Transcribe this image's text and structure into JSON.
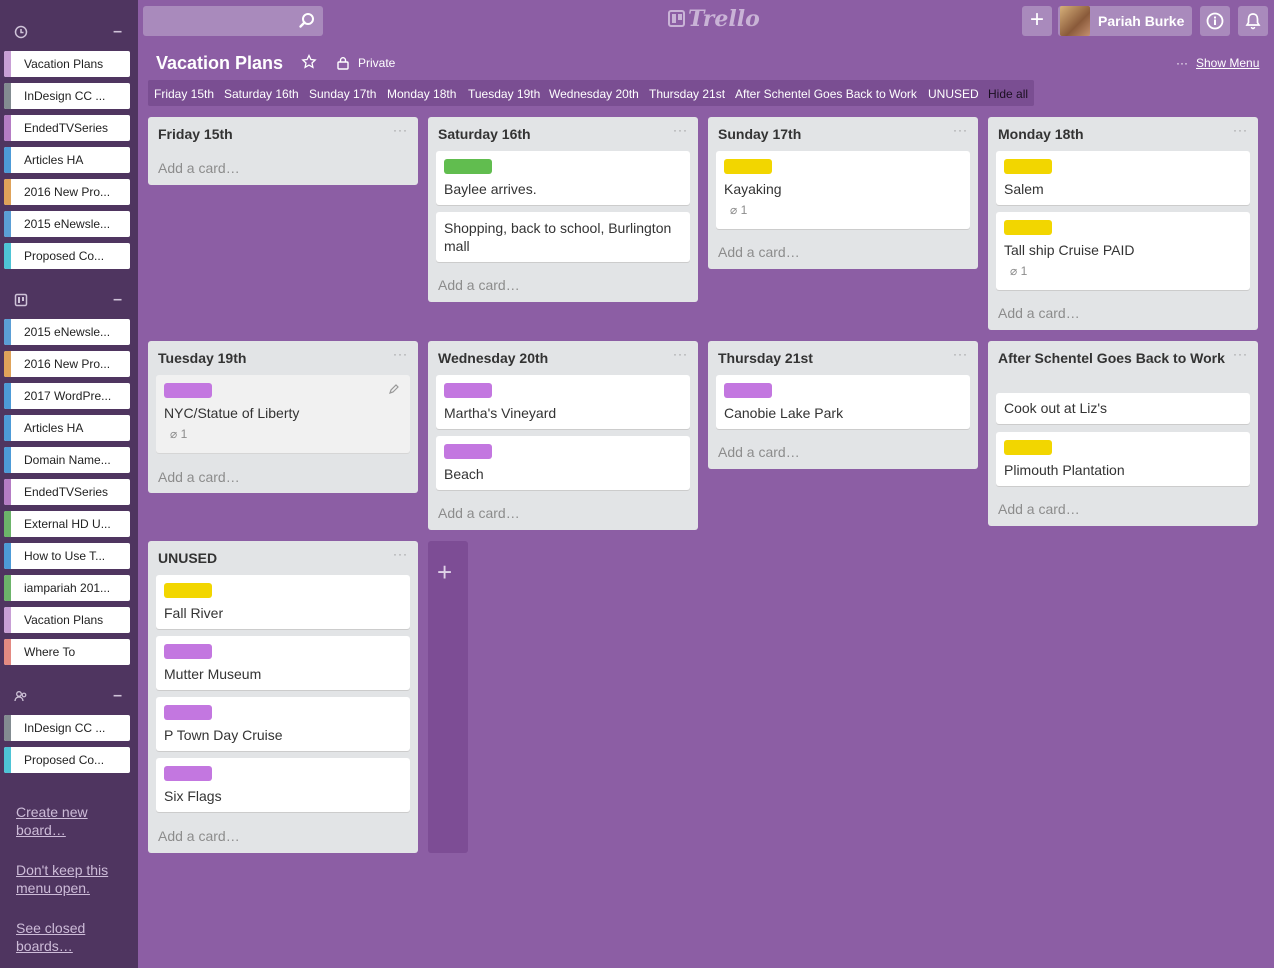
{
  "colors": {
    "sidebar_bg": "#4f3560",
    "board_bg": "#8c5ea4",
    "green": "#61bd4f",
    "yellow": "#f2d600",
    "purple": "#c377e0"
  },
  "sidebar": {
    "groups": [
      {
        "icon": "clock-icon",
        "items": [
          {
            "label": "Vacation Plans",
            "color": "#c89fd5"
          },
          {
            "label": "InDesign CC ...",
            "color": "#838c91"
          },
          {
            "label": "EndedTVSeries",
            "color": "#b57cc4"
          },
          {
            "label": "Articles HA",
            "color": "#4d9bd8"
          },
          {
            "label": "2016 New Pro...",
            "color": "#e0a35a"
          },
          {
            "label": "2015 eNewsle...",
            "color": "#5b9fd6"
          },
          {
            "label": "Proposed Co...",
            "color": "#4ec4d6"
          }
        ]
      },
      {
        "icon": "board-icon",
        "items": [
          {
            "label": "2015 eNewsle...",
            "color": "#5b9fd6"
          },
          {
            "label": "2016 New Pro...",
            "color": "#e0a35a"
          },
          {
            "label": "2017 WordPre...",
            "color": "#4d9bd8"
          },
          {
            "label": "Articles HA",
            "color": "#4d9bd8"
          },
          {
            "label": "Domain Name...",
            "color": "#4d9bd8"
          },
          {
            "label": "EndedTVSeries",
            "color": "#b57cc4"
          },
          {
            "label": "External HD U...",
            "color": "#6cb46a"
          },
          {
            "label": "How to Use T...",
            "color": "#4d9bd8"
          },
          {
            "label": "iampariah 201...",
            "color": "#6cb46a"
          },
          {
            "label": "Vacation Plans",
            "color": "#c89fd5"
          },
          {
            "label": "Where To",
            "color": "#e48a82"
          }
        ]
      },
      {
        "icon": "team-icon",
        "items": [
          {
            "label": "InDesign CC ...",
            "color": "#838c91"
          },
          {
            "label": "Proposed Co...",
            "color": "#4ec4d6"
          }
        ]
      }
    ],
    "links": [
      "Create new board…",
      "Don't keep this menu open.",
      "See closed boards…"
    ]
  },
  "header": {
    "logo": "Trello",
    "user_name": "Pariah Burke"
  },
  "board": {
    "title": "Vacation Plans",
    "privacy": "Private",
    "show_menu": "Show Menu",
    "filters": [
      "Friday 15th",
      "Saturday 16th",
      "Sunday 17th",
      "Monday 18th",
      "Tuesday 19th",
      "Wednesday 20th",
      "Thursday 21st",
      "After Schentel Goes Back to Work",
      "UNUSED",
      "Hide all"
    ],
    "add_card": "Add a card…",
    "lists": [
      {
        "title": "Friday 15th",
        "cards": []
      },
      {
        "title": "Saturday 16th",
        "cards": [
          {
            "label": "green",
            "text": "Baylee arrives."
          },
          {
            "label": null,
            "text": "Shopping, back to school, Burlington mall"
          }
        ]
      },
      {
        "title": "Sunday 17th",
        "cards": [
          {
            "label": "yellow",
            "text": "Kayaking",
            "attachments": "1"
          }
        ]
      },
      {
        "title": "Monday 18th",
        "cards": [
          {
            "label": "yellow",
            "text": "Salem"
          },
          {
            "label": "yellow",
            "text": "Tall ship Cruise PAID",
            "attachments": "1"
          }
        ]
      },
      {
        "title": "Tuesday 19th",
        "cards": [
          {
            "label": "purple",
            "text": "NYC/Statue of Liberty",
            "attachments": "1"
          }
        ]
      },
      {
        "title": "Wednesday 20th",
        "cards": [
          {
            "label": "purple",
            "text": "Martha's Vineyard"
          },
          {
            "label": "purple",
            "text": "Beach"
          }
        ]
      },
      {
        "title": "Thursday 21st",
        "cards": [
          {
            "label": "purple",
            "text": "Canobie Lake Park"
          }
        ]
      },
      {
        "title": "After Schentel Goes Back to Work",
        "cards": [
          {
            "label": null,
            "text": "Cook out at Liz's"
          },
          {
            "label": "yellow",
            "text": "Plimouth Plantation"
          }
        ]
      },
      {
        "title": "UNUSED",
        "cards": [
          {
            "label": "yellow",
            "text": "Fall River"
          },
          {
            "label": "purple",
            "text": "Mutter Museum"
          },
          {
            "label": "purple",
            "text": "P Town Day Cruise"
          },
          {
            "label": "purple",
            "text": "Six Flags"
          }
        ]
      }
    ]
  }
}
